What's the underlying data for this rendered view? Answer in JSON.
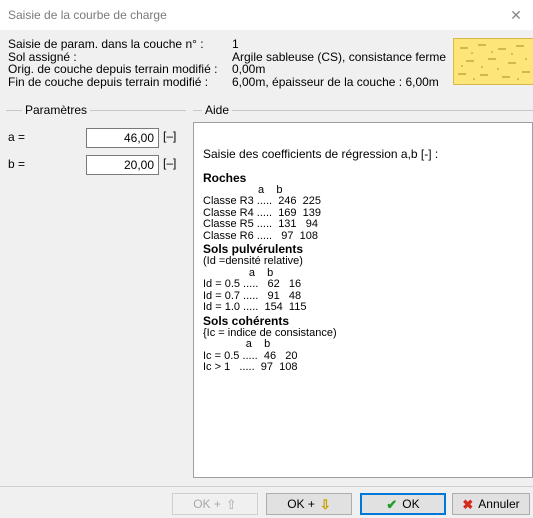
{
  "window": {
    "title": "Saisie de la courbe de charge",
    "close_glyph": "✕"
  },
  "info": {
    "rows": [
      {
        "label": "Saisie de param. dans la couche n° :",
        "value": "1"
      },
      {
        "label": "Sol assigné :",
        "value": "Argile sableuse (CS), consistance ferme"
      },
      {
        "label": "Orig. de couche depuis terrain modifié :",
        "value": "0,00m"
      },
      {
        "label": "Fin de couche depuis terrain modifié :",
        "value": "6,00m, épaisseur de la couche : 6,00m"
      }
    ],
    "swatch_color": "#fde57a"
  },
  "params": {
    "legend": "Paramètres",
    "a": {
      "label": "a =",
      "value": "46,00",
      "unit": "[–]"
    },
    "b": {
      "label": "b =",
      "value": "20,00",
      "unit": "[–]"
    }
  },
  "aide": {
    "legend": "Aide",
    "intro": "Saisie des coefficients de régression a,b [-] :",
    "s1_head": "Roches",
    "s1_body": "                  a    b\nClasse R3 .....  246  225\nClasse R4 .....  169  139\nClasse R5 .....  131   94\nClasse R6 .....   97  108",
    "s2_head": "Sols pulvérulents",
    "s2_body": "(Id =densité relative)\n               a    b\nId = 0.5 .....   62   16\nId = 0.7 .....   91   48\nId = 1.0 .....  154  115",
    "s3_head": "Sols cohérents",
    "s3_body": "{Ic = indice de consistance)\n              a    b\nIc = 0.5 .....  46   20\nIc > 1   .....  97  108"
  },
  "buttons": {
    "ok_up": "OK +",
    "ok_down": "OK +",
    "ok": "OK",
    "cancel": "Annuler"
  },
  "colors": {
    "ok_check": "#1f9c2a",
    "arrow_down": "#c8a000",
    "cancel_x": "#d6281c"
  }
}
